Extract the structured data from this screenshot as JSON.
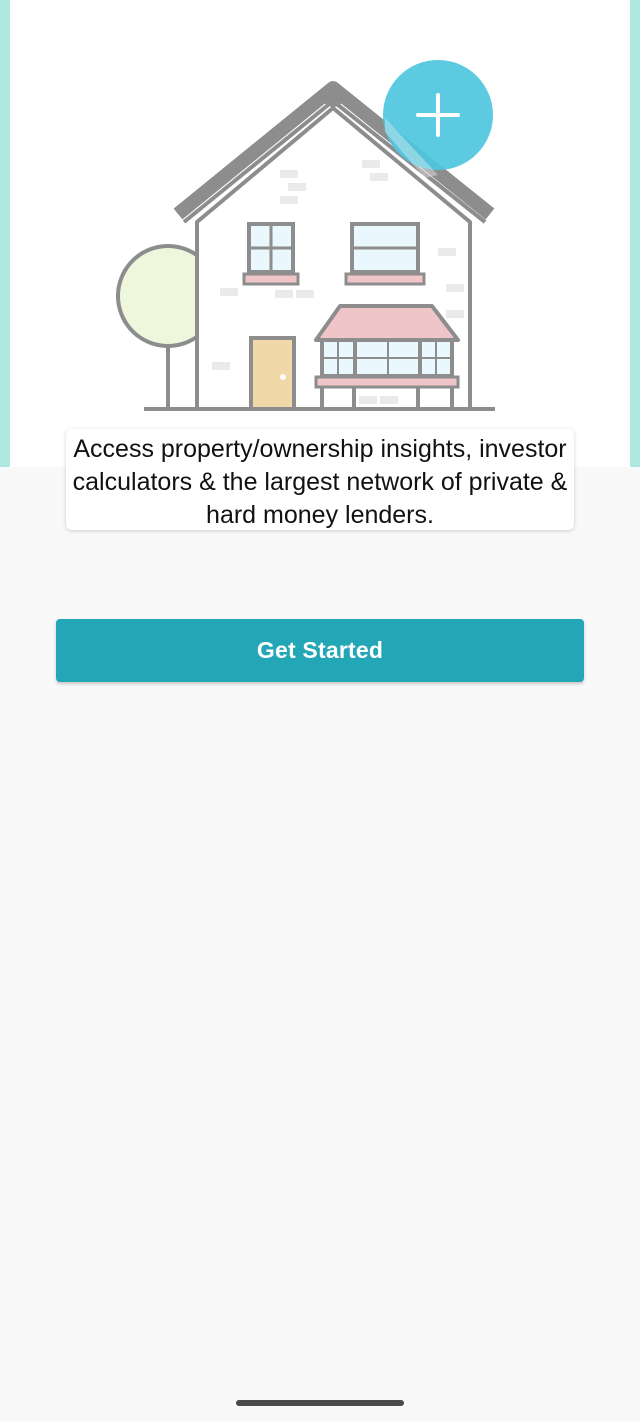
{
  "onboarding": {
    "illustration_icon": "house-with-plus-icon",
    "tagline": "Access property/ownership insights, investor calculators & the largest network of private & hard money lenders.",
    "get_started_label": "Get Started"
  },
  "colors": {
    "accent": "#23a6b5",
    "hero_border": "#aee9e1",
    "plus_badge": "#4ec5de",
    "tree": "#eef6dc",
    "door": "#f0d8a8",
    "awning": "#f0c5c8",
    "background": "#f9f9f9"
  }
}
